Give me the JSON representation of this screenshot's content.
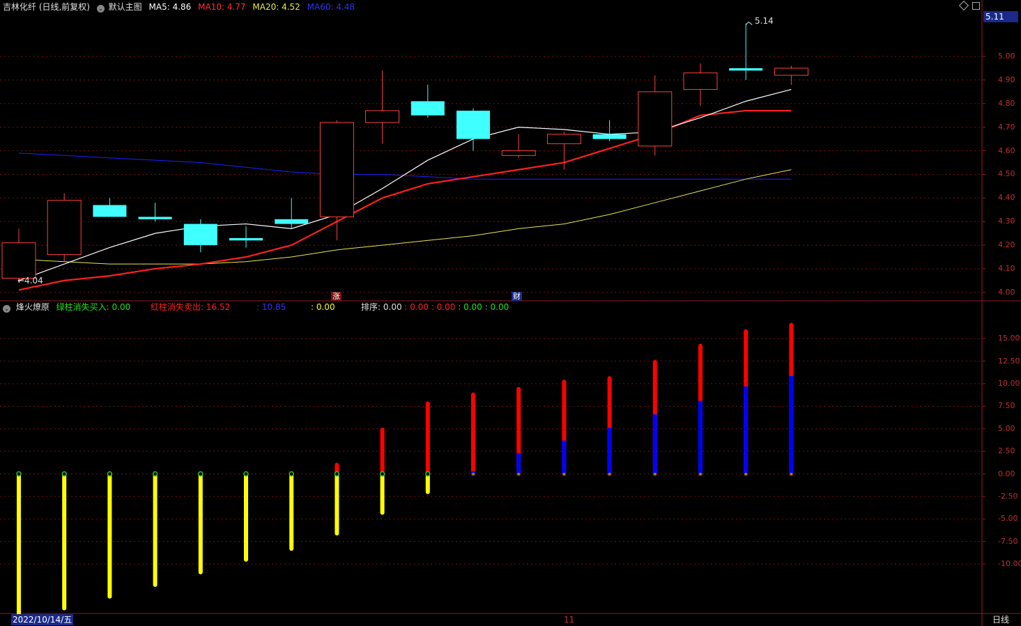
{
  "header": {
    "stock_title": "吉林化纤 (日线,前复权)",
    "main_indicator": "默认主图",
    "ma5_label": "MA5:",
    "ma5_value": "4.86",
    "ma10_label": "MA10:",
    "ma10_value": "4.77",
    "ma20_label": "MA20:",
    "ma20_value": "4.52",
    "ma60_label": "MA60:",
    "ma60_value": "4.48",
    "price_box": "5.11"
  },
  "sub_header": {
    "indicator_name": "烽火燎原",
    "green_label": "绿柱消失买入:",
    "green_value": "0.00",
    "red_label": "红柱消失卖出:",
    "red_value": "16.52",
    "blue_text": ": 10.85",
    "yellow_text": ": 0.00",
    "sort_label": "排序:",
    "sort_value": "0.00",
    "extra_red_1": ": 0.00",
    "extra_red_2": ": 0.00",
    "extra_green_1": ": 0.00",
    "extra_green_2": ": 0.00"
  },
  "annotations": {
    "high_label": "5.14",
    "low_label": "←4.04",
    "marker_zhang": "涨",
    "marker_cai": "财"
  },
  "footer": {
    "date": "2022/10/14/五",
    "month_marker": "11",
    "period": "日线"
  },
  "colors": {
    "background": "#000000",
    "up": "#ff4040",
    "down": "#40ffff",
    "ma5": "#ffffff",
    "ma10": "#ff2020",
    "ma20": "#e8e850",
    "ma60": "#2020ff",
    "bar_yellow": "#ffff00",
    "bar_red": "#ff0000",
    "bar_blue": "#0000ff",
    "grid": "#7a1010"
  },
  "chart_data": [
    {
      "type": "candlestick",
      "ylim": [
        3.97,
        5.18
      ],
      "yticks": [
        "4.00",
        "4.10",
        "4.20",
        "4.30",
        "4.40",
        "4.50",
        "4.60",
        "4.70",
        "4.80",
        "4.90",
        "5.00"
      ],
      "ohlc": [
        {
          "o": 4.06,
          "h": 4.27,
          "l": 4.04,
          "c": 4.21
        },
        {
          "o": 4.16,
          "h": 4.42,
          "l": 4.13,
          "c": 4.39
        },
        {
          "o": 4.37,
          "h": 4.4,
          "l": 4.32,
          "c": 4.32
        },
        {
          "o": 4.32,
          "h": 4.38,
          "l": 4.3,
          "c": 4.31
        },
        {
          "o": 4.29,
          "h": 4.31,
          "l": 4.17,
          "c": 4.2
        },
        {
          "o": 4.23,
          "h": 4.28,
          "l": 4.19,
          "c": 4.22
        },
        {
          "o": 4.31,
          "h": 4.4,
          "l": 4.27,
          "c": 4.29
        },
        {
          "o": 4.32,
          "h": 4.73,
          "l": 4.22,
          "c": 4.72
        },
        {
          "o": 4.72,
          "h": 4.94,
          "l": 4.63,
          "c": 4.77
        },
        {
          "o": 4.81,
          "h": 4.88,
          "l": 4.74,
          "c": 4.75
        },
        {
          "o": 4.77,
          "h": 4.78,
          "l": 4.6,
          "c": 4.65
        },
        {
          "o": 4.58,
          "h": 4.67,
          "l": 4.57,
          "c": 4.6
        },
        {
          "o": 4.63,
          "h": 4.68,
          "l": 4.52,
          "c": 4.67
        },
        {
          "o": 4.67,
          "h": 4.73,
          "l": 4.64,
          "c": 4.65
        },
        {
          "o": 4.62,
          "h": 4.92,
          "l": 4.58,
          "c": 4.85
        },
        {
          "o": 4.86,
          "h": 4.97,
          "l": 4.79,
          "c": 4.93
        },
        {
          "o": 4.95,
          "h": 5.14,
          "l": 4.9,
          "c": 4.94
        },
        {
          "o": 4.92,
          "h": 4.96,
          "l": 4.88,
          "c": 4.95
        }
      ],
      "ma5": [
        4.05,
        4.12,
        4.19,
        4.25,
        4.28,
        4.29,
        4.27,
        4.33,
        4.44,
        4.56,
        4.65,
        4.7,
        4.69,
        4.67,
        4.68,
        4.74,
        4.81,
        4.86
      ],
      "ma10": [
        4.01,
        4.05,
        4.07,
        4.1,
        4.12,
        4.15,
        4.2,
        4.3,
        4.4,
        4.46,
        4.49,
        4.52,
        4.55,
        4.61,
        4.67,
        4.75,
        4.77,
        4.77
      ],
      "ma20": [
        4.14,
        4.13,
        4.12,
        4.12,
        4.12,
        4.13,
        4.15,
        4.18,
        4.2,
        4.22,
        4.24,
        4.27,
        4.29,
        4.33,
        4.38,
        4.43,
        4.48,
        4.52
      ],
      "ma60": [
        4.59,
        4.58,
        4.57,
        4.56,
        4.55,
        4.53,
        4.51,
        4.5,
        4.5,
        4.49,
        4.48,
        4.48,
        4.48,
        4.48,
        4.48,
        4.48,
        4.48,
        4.48
      ]
    },
    {
      "type": "bar",
      "title": "烽火燎原",
      "ylim": [
        -15.4,
        17.8
      ],
      "yticks": [
        "15.00",
        "12.50",
        "10.00",
        "7.50",
        "5.00",
        "2.50",
        "0.00",
        "-2.50",
        "-5.00",
        "-7.50",
        "-10.00"
      ],
      "series": [
        {
          "color": "yellow",
          "values": [
            -16.0,
            -14.9,
            -13.6,
            -12.3,
            -10.9,
            -9.5,
            -8.3,
            -6.6,
            -4.3,
            -2.0,
            0,
            0,
            0,
            0,
            0,
            0,
            0,
            0
          ]
        },
        {
          "color": "red",
          "values": [
            0,
            0,
            0,
            0,
            0,
            0,
            0,
            1.0,
            4.9,
            7.8,
            8.8,
            9.4,
            10.2,
            10.6,
            12.4,
            14.2,
            15.8,
            16.52
          ]
        },
        {
          "color": "blue",
          "values": [
            0,
            0,
            0,
            0,
            0,
            0,
            0,
            0,
            0,
            0,
            0.3,
            2.3,
            3.7,
            5.1,
            6.6,
            8.1,
            9.7,
            10.85
          ]
        }
      ]
    }
  ]
}
